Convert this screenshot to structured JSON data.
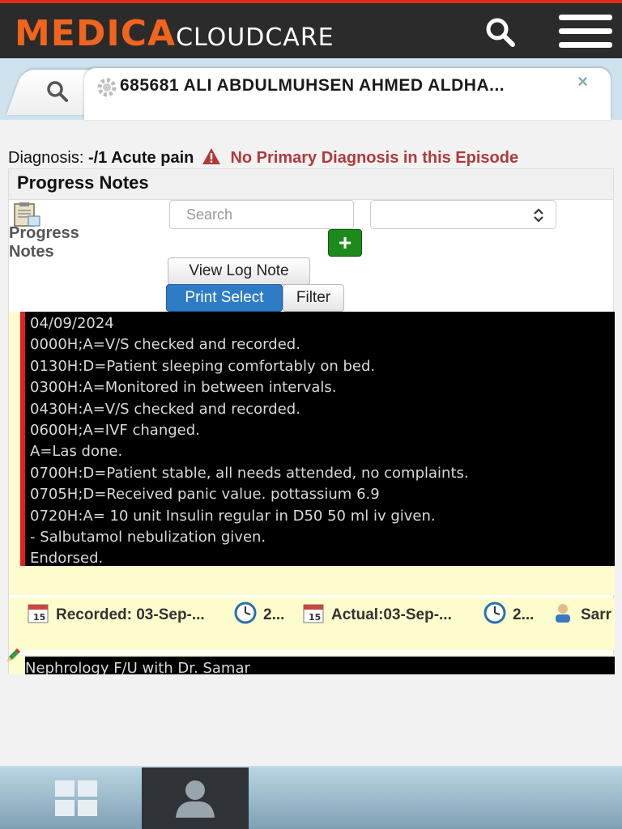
{
  "header": {
    "logo_primary": "MEDICA",
    "logo_secondary": "CLOUDCARE",
    "icons": [
      "search-icon",
      "hamburger-menu-icon"
    ]
  },
  "tabs": {
    "search_tab_icon": "search-icon",
    "patient_tab_title": "685681 ALI ABDULMUHSEN AHMED ALDHA...",
    "close_label": "×"
  },
  "diagnosis": {
    "label": "Diagnosis:",
    "value": "-/1 Acute pain",
    "warning": "No Primary Diagnosis in this Episode"
  },
  "panel": {
    "title": "Progress Notes",
    "section_label_line1": "Progress",
    "section_label_line2": "Notes",
    "search_placeholder": "Search",
    "select_value": "",
    "add_button_label": "+",
    "view_log_label": "View Log Note",
    "print_select_label": "Print Select",
    "filter_label": "Filter"
  },
  "note1": {
    "lines": [
      "04/09/2024",
      "0000H;A=V/S checked and recorded.",
      "0130H:D=Patient sleeping comfortably on bed.",
      "0300H:A=Monitored in between intervals.",
      "0430H:A=V/S checked and recorded.",
      "0600H;A=IVF changed.",
      "A=Las done.",
      "0700H:D=Patient stable, all needs attended, no complaints.",
      "0705H;D=Received panic value. pottassium 6.9",
      "0720H:A= 10 unit Insulin regular in D50 50 ml iv given.",
      "- Salbutamol nebulization given.",
      "Endorsed."
    ]
  },
  "meta": {
    "recorded": "Recorded: 03-Sep-...",
    "recorded_time": "2...",
    "actual": "Actual:03-Sep-...",
    "actual_time": "2...",
    "user": "Sarr"
  },
  "note2": {
    "first_line": "Nephrology F/U with Dr. Samar"
  },
  "colors": {
    "brand_orange": "#f0641e",
    "alert_red": "#b03a3a",
    "note_bg": "#fdfccc",
    "print_button_blue": "#2f7cc6",
    "add_button_green": "#1c8a1c"
  }
}
